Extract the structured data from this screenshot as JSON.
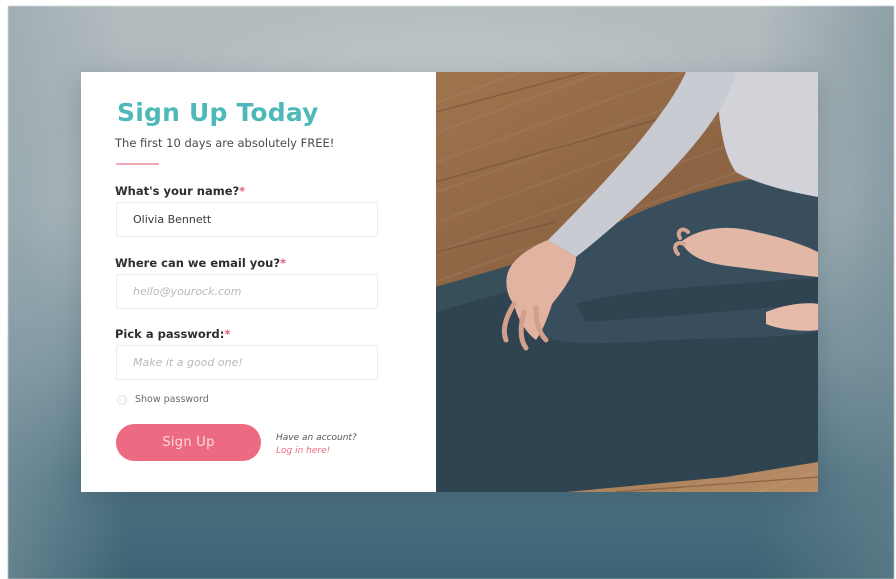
{
  "form": {
    "title": "Sign Up Today",
    "subtitle": "The first 10 days are absolutely FREE!",
    "required_mark": "*",
    "name_label": "What's your name?",
    "name_value": "Olivia Bennett",
    "email_label": "Where can we email you?",
    "email_placeholder": "hello@yourock.com",
    "password_label": "Pick a password:",
    "password_placeholder": "Make it a good one!",
    "show_password_label": "Show password",
    "submit_label": "Sign Up",
    "login_prompt": "Have an account?",
    "login_link": "Log in here!"
  },
  "colors": {
    "title": "#4fb8b8",
    "accent": "#ec6a82",
    "required": "#e45c76"
  },
  "photo": {
    "subject": "yoga-meditation-photo"
  }
}
